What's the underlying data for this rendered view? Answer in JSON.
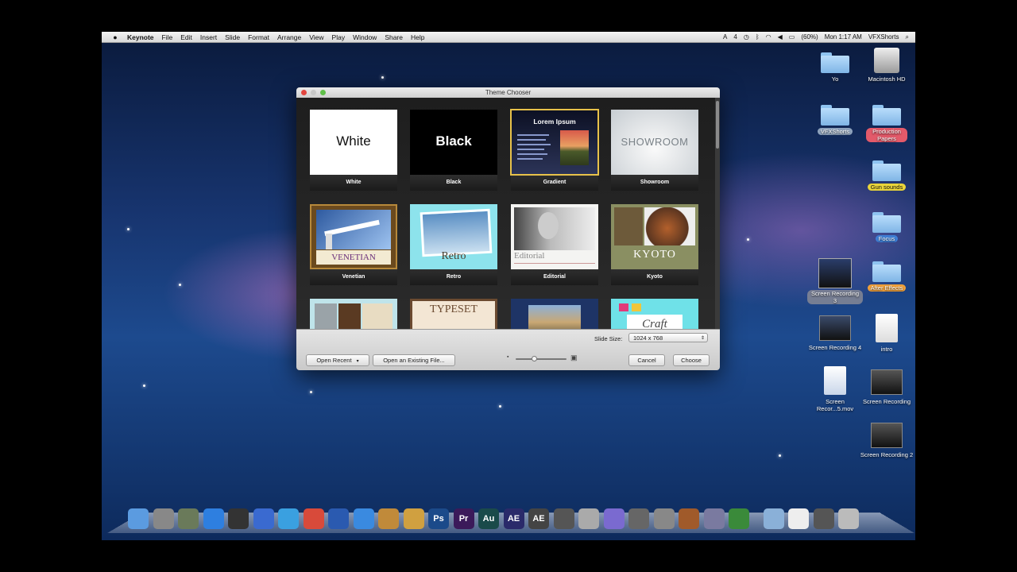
{
  "menubar": {
    "app_name": "Keynote",
    "items": [
      "File",
      "Edit",
      "Insert",
      "Slide",
      "Format",
      "Arrange",
      "View",
      "Play",
      "Window",
      "Share",
      "Help"
    ],
    "status_text": "4",
    "battery": "(60%)",
    "clock": "Mon 1:17 AM",
    "user": "VFXShorts"
  },
  "window": {
    "title": "Theme Chooser",
    "themes": [
      {
        "name": "White",
        "preview_text": "White"
      },
      {
        "name": "Black",
        "preview_text": "Black"
      },
      {
        "name": "Gradient",
        "preview_text": "Lorem Ipsum"
      },
      {
        "name": "Showroom",
        "preview_text": "SHOWROOM"
      },
      {
        "name": "Venetian",
        "preview_text": "VENETIAN"
      },
      {
        "name": "Retro",
        "preview_text": "Retro"
      },
      {
        "name": "Editorial",
        "preview_text": "Editorial"
      },
      {
        "name": "Kyoto",
        "preview_text": "KYOTO"
      },
      {
        "name": "",
        "preview_text": ""
      },
      {
        "name": "",
        "preview_text": "TYPESET"
      },
      {
        "name": "",
        "preview_text": ""
      },
      {
        "name": "",
        "preview_text": "Craft"
      }
    ],
    "slide_size_label": "Slide Size:",
    "slide_size_value": "1024 x 768",
    "open_recent_label": "Open Recent",
    "open_existing_label": "Open an Existing File...",
    "cancel_label": "Cancel",
    "choose_label": "Choose"
  },
  "desktop": {
    "icons": [
      {
        "label": "Yo"
      },
      {
        "label": "Macintosh HD"
      },
      {
        "label": "VFXShorts"
      },
      {
        "label": "Production Papers"
      },
      {
        "label": "Gun sounds"
      },
      {
        "label": "Focus"
      },
      {
        "label": "Screen Recording 3"
      },
      {
        "label": "After Effects"
      },
      {
        "label": "Screen Recording 4"
      },
      {
        "label": "intro"
      },
      {
        "label": "Screen Recor...5.mov"
      },
      {
        "label": "Screen Recording"
      },
      {
        "label": "Screen Recording 2"
      }
    ]
  },
  "dock": {
    "items": [
      {
        "icon": "finder-icon",
        "text": ""
      },
      {
        "icon": "launchpad-icon",
        "text": ""
      },
      {
        "icon": "system-info-icon",
        "text": ""
      },
      {
        "icon": "app-store-icon",
        "text": ""
      },
      {
        "icon": "dashboard-icon",
        "text": ""
      },
      {
        "icon": "mail-icon",
        "text": ""
      },
      {
        "icon": "safari-icon",
        "text": ""
      },
      {
        "icon": "chrome-icon",
        "text": ""
      },
      {
        "icon": "quicktime-icon",
        "text": ""
      },
      {
        "icon": "itunes-icon",
        "text": ""
      },
      {
        "icon": "preview-icon",
        "text": ""
      },
      {
        "icon": "iphoto-icon",
        "text": ""
      },
      {
        "icon": "photoshop-icon",
        "text": "Ps"
      },
      {
        "icon": "premiere-icon",
        "text": "Pr"
      },
      {
        "icon": "audition-icon",
        "text": "Au"
      },
      {
        "icon": "after-effects-icon",
        "text": "AE"
      },
      {
        "icon": "ae-script-icon",
        "text": "AE"
      },
      {
        "icon": "final-cut-icon",
        "text": ""
      },
      {
        "icon": "utility-icon",
        "text": ""
      },
      {
        "icon": "motion-icon",
        "text": ""
      },
      {
        "icon": "tools-icon",
        "text": ""
      },
      {
        "icon": "system-preferences-icon",
        "text": ""
      },
      {
        "icon": "keynote-icon",
        "text": ""
      },
      {
        "icon": "script-editor-icon",
        "text": ""
      },
      {
        "icon": "numbers-icon",
        "text": ""
      },
      {
        "icon": "applications-folder-icon",
        "text": ""
      },
      {
        "icon": "documents-icon",
        "text": ""
      },
      {
        "icon": "downloads-icon",
        "text": ""
      },
      {
        "icon": "trash-icon",
        "text": ""
      }
    ]
  },
  "colors": {
    "selection_border": "#e8c24a",
    "window_dark": "#2a2a2a"
  }
}
